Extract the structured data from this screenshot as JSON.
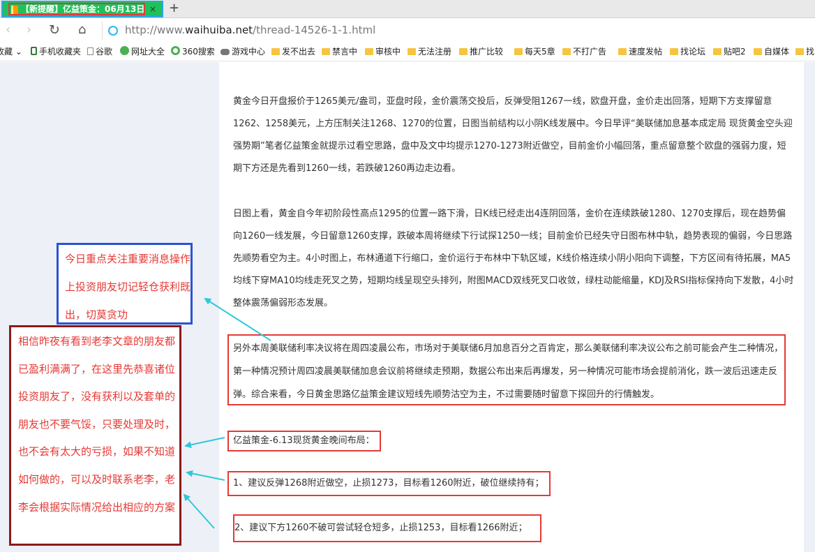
{
  "browser": {
    "tab": {
      "title": "【新提醒】亿益策金：06月13日",
      "close": "×"
    },
    "new_tab": "+",
    "nav": {
      "back": "‹",
      "forward": "›",
      "reload": "↻",
      "home": "⌂"
    },
    "url": {
      "scheme_host": "http://www.",
      "domain": "waihuiba.net",
      "path": "/thread-14526-1-1.html"
    }
  },
  "bookmarks": [
    {
      "label": "收藏",
      "icon": "dropdown-icon"
    },
    {
      "label": "手机收藏夹",
      "icon": "phone-icon"
    },
    {
      "label": "谷歌",
      "icon": "page-icon"
    },
    {
      "label": "网址大全",
      "icon": "nav-icon"
    },
    {
      "label": "360搜索",
      "icon": "search-360-icon"
    },
    {
      "label": "游戏中心",
      "icon": "gamepad-icon"
    },
    {
      "label": "发不出去",
      "icon": "folder-icon"
    },
    {
      "label": "禁言中",
      "icon": "folder-icon"
    },
    {
      "label": "审核中",
      "icon": "folder-icon"
    },
    {
      "label": "无法注册",
      "icon": "folder-icon"
    },
    {
      "label": "推广比较",
      "icon": "folder-icon"
    },
    {
      "label": "每天5章",
      "icon": "folder-icon"
    },
    {
      "label": "不打广告",
      "icon": "folder-icon"
    },
    {
      "label": "速度发帖",
      "icon": "folder-icon"
    },
    {
      "label": "找论坛",
      "icon": "folder-icon"
    },
    {
      "label": "贴吧2",
      "icon": "folder-icon"
    },
    {
      "label": "自媒体",
      "icon": "folder-icon"
    },
    {
      "label": "找",
      "icon": "folder-icon"
    }
  ],
  "article": {
    "para1": "黄金今日开盘报价于1265美元/盎司，亚盘时段，金价震荡交投后，反弹受阻1267一线，欧盘开盘，金价走出回落，短期下方支撑留意1262、1258美元，上方压制关注1268、1270的位置，日图当前结构以小阴K线发展中。今日早评“美联储加息基本成定局 现货黄金空头迎强势期”笔者亿益策金就提示过看空思路，盘中及文中均提示1270-1273附近做空，目前金价小幅回落，重点留意整个欧盘的强弱力度，短期下方还是先看到1260一线，若跌破1260再边走边看。",
    "para2": "日图上看，黄金自今年初阶段性高点1295的位置一路下滑，日K线已经走出4连阴回落，金价在连续跌破1280、1270支撑后，现在趋势偏向1260一线发展，今日留意1260支撑，跌破本周将继续下行试探1250一线；目前金价已经失守日图布林中轨，趋势表现的偏弱，今日思路先顺势看空为主。4小时图上，布林通道下行缩口，金价运行于布林中下轨区域，K线价格连续小阴小阳向下调整，下方区间有待拓展，MA5均线下穿MA10均线走死叉之势，短期均线呈现空头排列，附图MACD双线死叉口收敛，绿柱动能缩量，KDJ及RSI指标保持向下发散，4小时整体震荡偏弱形态发展。",
    "para3": "另外本周美联储利率决议将在周四凌晨公布，市场对于美联储6月加息百分之百肯定，那么美联储利率决议公布之前可能会产生二种情况，第一种情况预计周四凌晨美联储加息会议前将继续走预期，数据公布出来后再爆发，另一种情况可能市场会提前消化，跌一波后迅速走反弹。综合来看，今日黄金思路亿益策金建议短线先顺势沽空为主，不过需要随时留意下探回升的行情触发。",
    "layout_title": "亿益策金-6.13现货黄金晚间布局：",
    "advice1": "1、建议反弹1268附近做空，止损1273，目标看1260附近，破位继续持有；",
    "advice2": "2、建议下方1260不破可尝试轻仓短多，止损1253，目标看1266附近；"
  },
  "callouts": {
    "blue": "今日重点关注重要消息操作上投资朋友切记轻仓获利既出，切莫贪功",
    "red": "相信昨夜有看到老李文章的朋友都已盈利满满了，在这里先恭喜诸位投资朋友了，没有获利以及套单的朋友也不要气馁，只要处理及时，也不会有太大的亏损，如果不知道如何做的，可以及时联系老李，老李会根据实际情况给出相应的方案"
  },
  "colors": {
    "tab_bg": "#1ec25b",
    "highlight_red": "#e53935",
    "callout_blue": "#2b53d1",
    "callout_dark_red": "#8b1a1a",
    "arrow": "#2ec8d8"
  }
}
